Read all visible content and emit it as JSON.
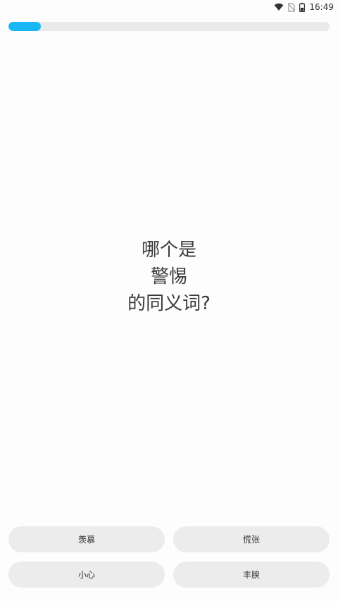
{
  "status_bar": {
    "time": "16:49",
    "icons": [
      "wifi-icon",
      "no-sim-icon",
      "battery-icon"
    ]
  },
  "progress": {
    "fraction": 0.1,
    "color": "#19b8f4"
  },
  "question": {
    "line1": "哪个是",
    "line2": "警惕",
    "line3": "的同义词?"
  },
  "answers": [
    {
      "label": "羡慕"
    },
    {
      "label": "慌张"
    },
    {
      "label": "小心"
    },
    {
      "label": "丰腴"
    }
  ]
}
